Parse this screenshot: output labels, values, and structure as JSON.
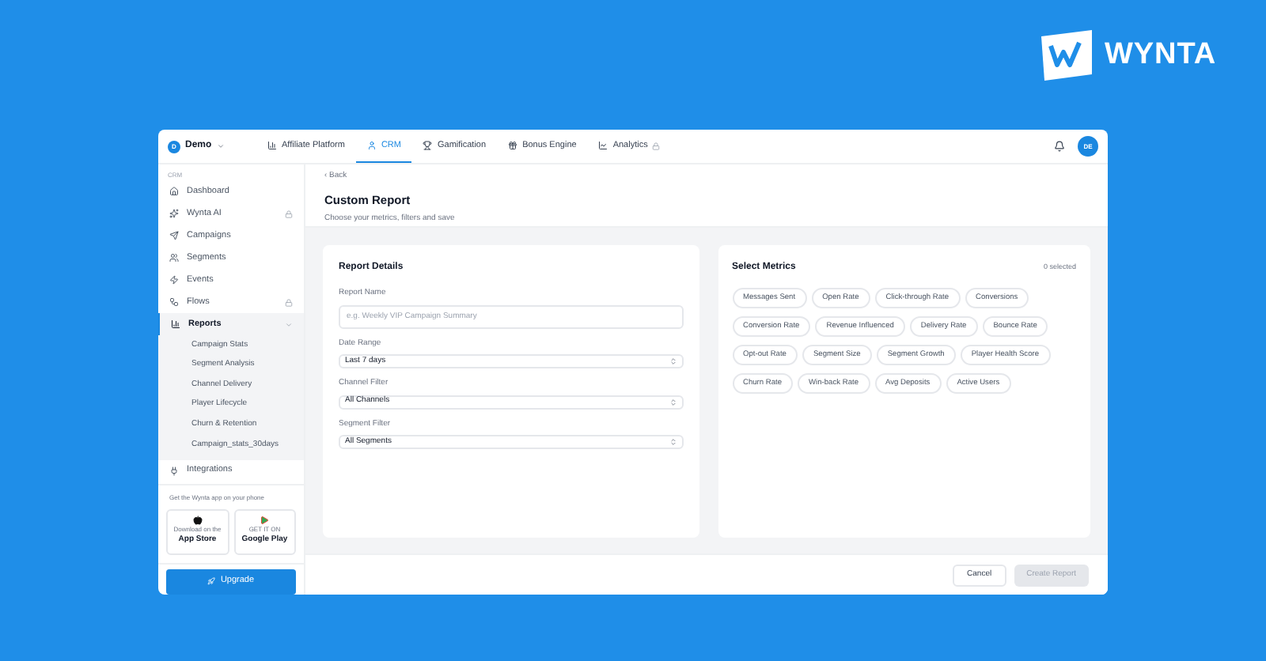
{
  "brand": {
    "name": "WYNTA"
  },
  "workspace": {
    "initial": "D",
    "name": "Demo"
  },
  "nav_tabs": [
    {
      "label": "Affiliate Platform",
      "selected": false,
      "locked": false
    },
    {
      "label": "CRM",
      "selected": true,
      "locked": false
    },
    {
      "label": "Gamification",
      "selected": false,
      "locked": false
    },
    {
      "label": "Bonus Engine",
      "selected": false,
      "locked": false
    },
    {
      "label": "Analytics",
      "selected": false,
      "locked": true
    }
  ],
  "user": {
    "initials": "DE"
  },
  "sidebar": {
    "section": "CRM",
    "items": [
      {
        "label": "Dashboard",
        "selected": false,
        "locked": false
      },
      {
        "label": "Wynta AI",
        "selected": false,
        "locked": true
      },
      {
        "label": "Campaigns",
        "selected": false,
        "locked": false
      },
      {
        "label": "Segments",
        "selected": false,
        "locked": false
      },
      {
        "label": "Events",
        "selected": false,
        "locked": false
      },
      {
        "label": "Flows",
        "selected": false,
        "locked": true
      },
      {
        "label": "Reports",
        "selected": true,
        "locked": false,
        "expanded": true,
        "children": [
          {
            "label": "Campaign Stats"
          },
          {
            "label": "Segment Analysis"
          },
          {
            "label": "Channel Delivery"
          },
          {
            "label": "Player Lifecycle"
          },
          {
            "label": "Churn & Retention"
          },
          {
            "label": "Campaign_stats_30days"
          }
        ]
      },
      {
        "label": "Integrations",
        "selected": false,
        "locked": false
      }
    ],
    "app_promo": {
      "text": "Get the Wynta app on your phone",
      "stores": [
        {
          "kind": "apple",
          "caption": "Download on the",
          "name": "App Store"
        },
        {
          "kind": "google",
          "caption": "GET IT ON",
          "name": "Google Play"
        }
      ]
    },
    "upgrade_button": "Upgrade"
  },
  "page": {
    "back": "‹ Back",
    "title": "Custom Report",
    "subtitle": "Choose your metrics, filters and save"
  },
  "report_details": {
    "title": "Report Details",
    "fields": [
      {
        "kind": "text",
        "label": "Report Name",
        "placeholder": "e.g. Weekly VIP Campaign Summary"
      },
      {
        "kind": "select",
        "label": "Date Range",
        "value": "Last 7 days"
      },
      {
        "kind": "select",
        "label": "Channel Filter",
        "value": "All Channels"
      },
      {
        "kind": "select",
        "label": "Segment Filter",
        "value": "All Segments"
      }
    ]
  },
  "select_metrics": {
    "title": "Select Metrics",
    "count": "0 selected",
    "metrics": [
      {
        "label": "Messages Sent",
        "selected": false
      },
      {
        "label": "Open Rate",
        "selected": false
      },
      {
        "label": "Click-through Rate",
        "selected": false
      },
      {
        "label": "Conversions",
        "selected": false
      },
      {
        "label": "Conversion Rate",
        "selected": false
      },
      {
        "label": "Revenue Influenced",
        "selected": false
      },
      {
        "label": "Delivery Rate",
        "selected": false
      },
      {
        "label": "Bounce Rate",
        "selected": false
      },
      {
        "label": "Opt-out Rate",
        "selected": false
      },
      {
        "label": "Segment Size",
        "selected": false
      },
      {
        "label": "Segment Growth",
        "selected": false
      },
      {
        "label": "Player Health Score",
        "selected": false
      },
      {
        "label": "Churn Rate",
        "selected": false
      },
      {
        "label": "Win-back Rate",
        "selected": false
      },
      {
        "label": "Avg Deposits",
        "selected": false
      },
      {
        "label": "Active Users",
        "selected": false
      }
    ]
  },
  "footer": {
    "buttons": [
      {
        "label": "Cancel",
        "disabled": false
      },
      {
        "label": "Create Report",
        "disabled": true
      }
    ]
  }
}
